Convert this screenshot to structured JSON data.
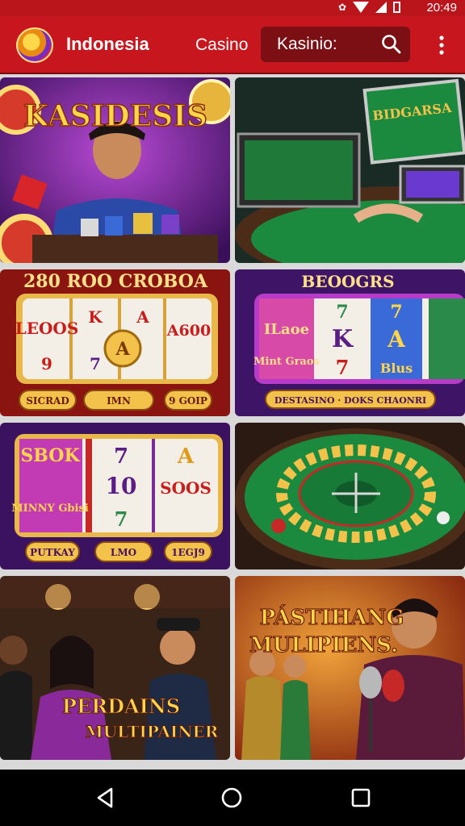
{
  "status": {
    "time": "20:49"
  },
  "header": {
    "title": "Indonesia",
    "tab": "Casino",
    "search_value": "Kasinio:"
  },
  "tiles": [
    {
      "title": "KASIDESIS"
    },
    {
      "title": "BIDGARSA"
    },
    {
      "title": "280 ROO CROBOA",
      "reels": [
        "LEOOS",
        "K",
        "A",
        "A",
        "A600",
        "9",
        "7"
      ],
      "buttons": [
        "SICRAD",
        "IMN",
        "9 GOIP"
      ]
    },
    {
      "title": "BEOOGRS",
      "reels": [
        "ILaoe",
        "7",
        "K",
        "A",
        "7",
        "Mint Graos",
        "7",
        "Blus"
      ],
      "buttons": [
        "DESTASINO · DOKS CHAONRI"
      ]
    },
    {
      "reels": [
        "SBOK",
        "7",
        "A",
        "10",
        "SOOS",
        "MINNY Gbisi",
        "7"
      ],
      "buttons": [
        "PUTKAY",
        "LMO",
        "1EGJ9"
      ]
    },
    {
      "title": ""
    },
    {
      "title": "PERDAINS MULTIPAINER"
    },
    {
      "title": "PÁSTIHANG MULIPIENS."
    }
  ],
  "colors": {
    "appbar": "#c8161e",
    "search_bg": "#7c0f14",
    "gold": "#f2c24a",
    "purple": "#5a1d86",
    "felt": "#1b8a3e"
  }
}
